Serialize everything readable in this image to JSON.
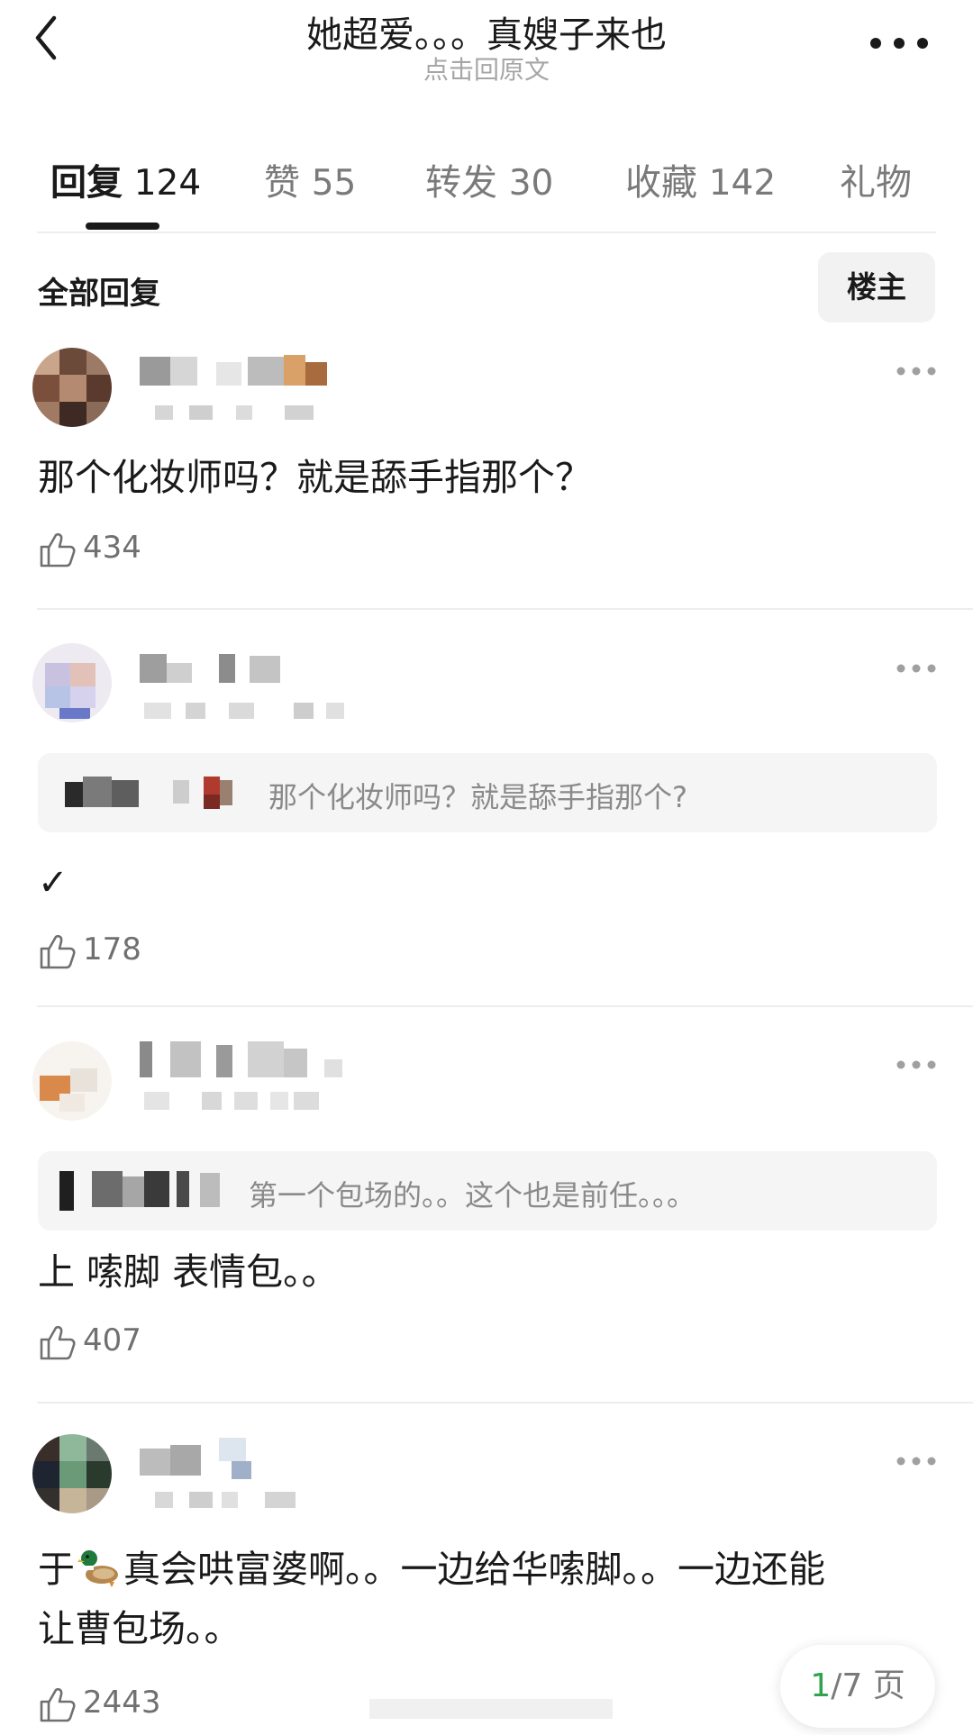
{
  "header": {
    "title": "她超爱。。。真嫂子来也",
    "subtitle": "点击回原文"
  },
  "tabs": [
    {
      "label": "回复",
      "count": "124",
      "active": true
    },
    {
      "label": "赞",
      "count": "55"
    },
    {
      "label": "转发",
      "count": "30"
    },
    {
      "label": "收藏",
      "count": "142"
    },
    {
      "label": "礼物",
      "count": ""
    }
  ],
  "section": {
    "title": "全部回复",
    "owner_button": "楼主"
  },
  "comments": [
    {
      "text": "那个化妆师吗？就是舔手指那个？",
      "likes": "434"
    },
    {
      "quote": "那个化妆师吗？就是舔手指那个?",
      "text": "✓",
      "likes": "178"
    },
    {
      "quote": "第一个包场的。。这个也是前任。。。",
      "text": "上 嗦脚 表情包。。",
      "likes": "407"
    },
    {
      "text_line1_a": "于",
      "text_line1_b": "真会哄富婆啊。。一边给华嗦脚。。一边还能",
      "text_line2": "让曹包场。。",
      "emoji_icon": "duck-icon",
      "likes": "2443"
    }
  ],
  "pagination": {
    "current": "1",
    "total": "/7",
    "unit": "页"
  },
  "colors": {
    "accent_green": "#2ea44f",
    "text_primary": "#1a1a1a",
    "text_secondary": "#7a7a7a",
    "quote_bg": "#f5f5f5"
  }
}
